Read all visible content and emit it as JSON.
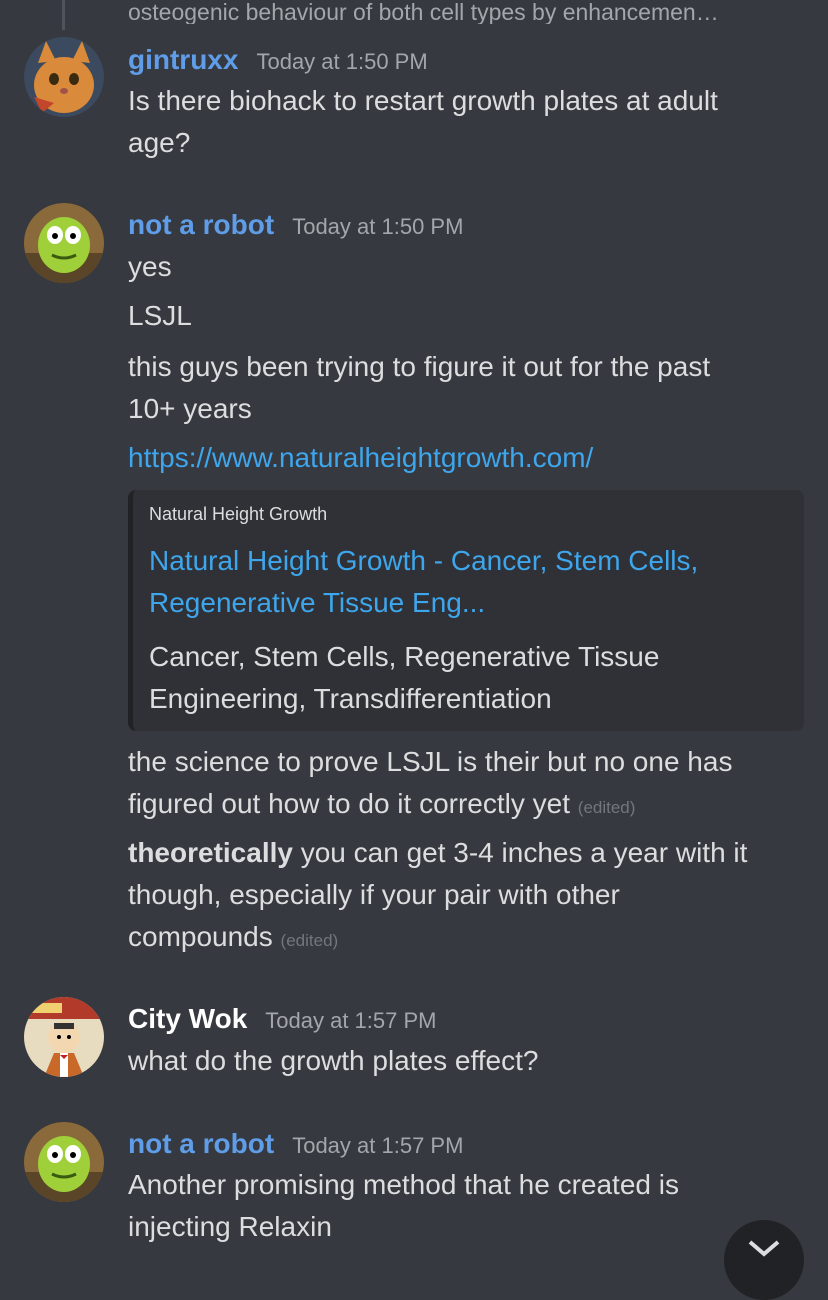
{
  "reply": {
    "preview": "osteogenic behaviour of both cell types by enhancemen…"
  },
  "messages": [
    {
      "author": "gintruxx",
      "author_color": "#5f9de8",
      "timestamp": "Today at 1:50 PM",
      "avatar": "orange-cat-avatar",
      "lines": [
        "Is there biohack to restart growth plates at adult",
        "age?"
      ]
    },
    {
      "author": "not a robot",
      "author_color": "#5f9de8",
      "timestamp": "Today at 1:50 PM",
      "avatar": "green-monster-avatar",
      "lines": [
        "yes",
        "LSJL",
        "this guys been trying to figure it out for the past",
        "10+ years"
      ],
      "link": "https://www.naturalheightgrowth.com/",
      "embed": {
        "provider": "Natural Height Growth",
        "title_lines": [
          "Natural Height Growth - Cancer, Stem Cells,",
          "Regenerative Tissue Eng..."
        ],
        "description_lines": [
          "Cancer, Stem Cells, Regenerative Tissue",
          "Engineering, Transdifferentiation"
        ]
      },
      "after_embed": [
        [
          "the science to prove LSJL is their but no one has",
          "figured out how to do it correctly yet"
        ],
        [
          "theoretically",
          " you can get 3-4 inches a year with it",
          "though, especially if your pair with other",
          "compounds"
        ]
      ],
      "edited_label": "(edited)"
    },
    {
      "author": "City Wok",
      "author_color": "#ffffff",
      "timestamp": "Today at 1:57 PM",
      "avatar": "city-wok-avatar",
      "lines": [
        "what do the growth plates effect?"
      ]
    },
    {
      "author": "not a robot",
      "author_color": "#5f9de8",
      "timestamp": "Today at 1:57 PM",
      "avatar": "green-monster-avatar",
      "lines": [
        "Another promising method that he created is",
        "injecting Relaxin"
      ]
    }
  ]
}
